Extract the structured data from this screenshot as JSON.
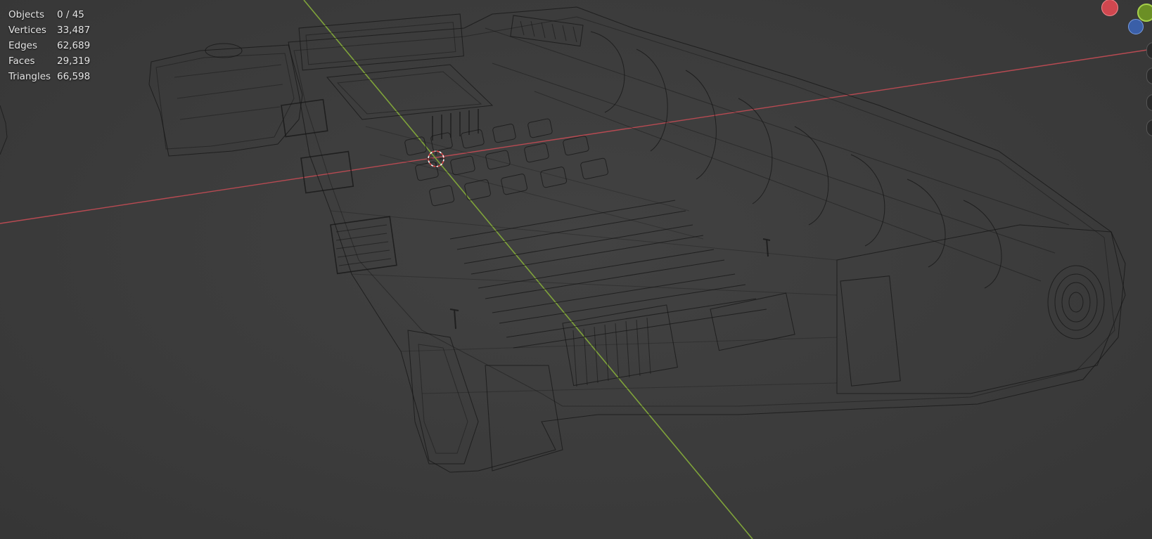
{
  "viewport": {
    "mode": "wireframe",
    "background_color": "#3c3c3c",
    "axis_colors": {
      "x": "#b84a52",
      "y": "#7fa33a"
    }
  },
  "stats": {
    "rows": [
      {
        "label": "Objects",
        "value": "0 / 45"
      },
      {
        "label": "Vertices",
        "value": "33,487"
      },
      {
        "label": "Edges",
        "value": "62,689"
      },
      {
        "label": "Faces",
        "value": "29,319"
      },
      {
        "label": "Triangles",
        "value": "66,598"
      }
    ]
  },
  "gizmo": {
    "x_color": "#d0474f",
    "y_color": "#6b8f25",
    "z_color": "#3a5fa8"
  },
  "nav_icons": [
    "zoom-icon",
    "hand-icon",
    "camera-icon",
    "grid-icon"
  ]
}
